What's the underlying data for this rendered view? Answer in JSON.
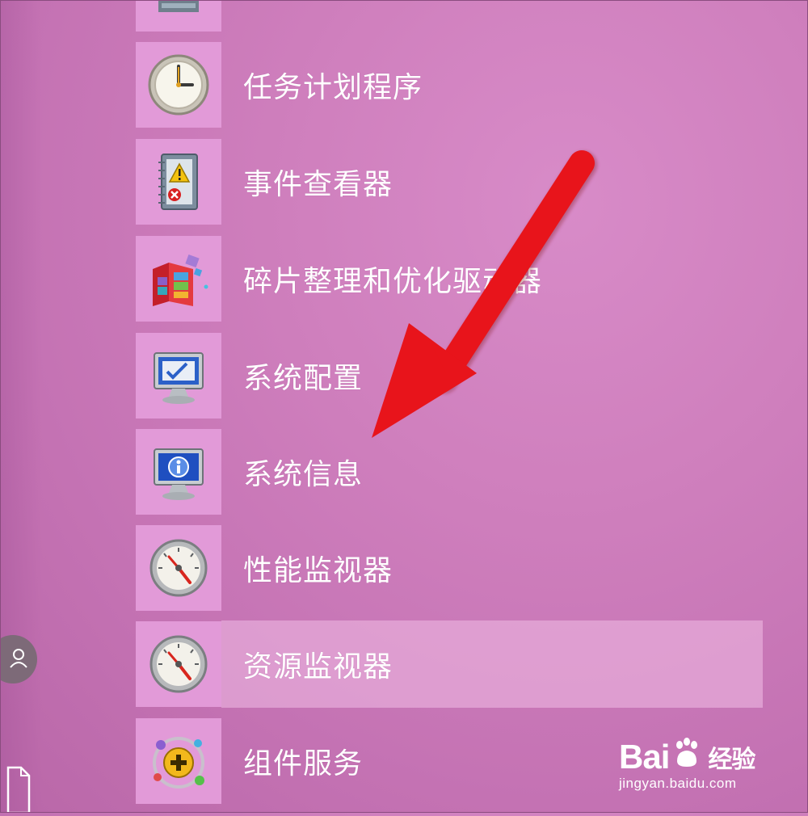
{
  "menu": {
    "items": [
      {
        "label": "",
        "icon": "server-icon"
      },
      {
        "label": "任务计划程序",
        "icon": "clock-icon"
      },
      {
        "label": "事件查看器",
        "icon": "event-viewer-icon"
      },
      {
        "label": "碎片整理和优化驱动器",
        "icon": "defragment-icon"
      },
      {
        "label": "系统配置",
        "icon": "system-config-icon"
      },
      {
        "label": "系统信息",
        "icon": "system-info-icon"
      },
      {
        "label": "性能监视器",
        "icon": "performance-gauge-icon"
      },
      {
        "label": "资源监视器",
        "icon": "resource-gauge-icon"
      },
      {
        "label": "组件服务",
        "icon": "component-services-icon"
      }
    ],
    "highlighted_index": 7
  },
  "annotation": {
    "arrow_color": "#e8141b",
    "arrow_points_to": "系统信息"
  },
  "watermark": {
    "brand": "Bai",
    "brand_suffix": "du",
    "product": "经验",
    "url": "jingyan.baidu.com"
  },
  "colors": {
    "background": "#cf7fbd",
    "tile": "#e29ad8",
    "highlight": "#e7b4dc",
    "text": "#ffffff"
  }
}
